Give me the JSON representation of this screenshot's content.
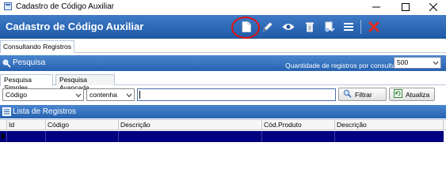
{
  "window": {
    "title": "Cadastro de Código Auxiliar",
    "controls": [
      "minimize",
      "maximize",
      "close"
    ]
  },
  "header": {
    "title": "Cadastro de Código Auxiliar",
    "toolbar_icons": [
      "new-document-icon",
      "edit-pencil-icon",
      "view-eye-icon",
      "delete-trash-icon",
      "import-icon",
      "menu-list-icon",
      "cancel-x-icon"
    ],
    "highlighted": "new-document-icon"
  },
  "context_tab": "Consultando Registros",
  "pesquisa": {
    "title": "Pesquisa",
    "qty_label": "Quantidade de registros por consulta :",
    "qty_value": "500"
  },
  "search_tabs": [
    {
      "label": "Pesquisa Simples",
      "active": true
    },
    {
      "label": "Pesquisa Avançada",
      "active": false
    }
  ],
  "search": {
    "field_value": "Código",
    "operator_value": "contenha",
    "text_value": "",
    "filter_button": "Filtrar",
    "refresh_button": "Atualiza"
  },
  "lista": {
    "title": "Lista de Registros",
    "columns": [
      "Id",
      "Código",
      "Descrição",
      "Cód.Produto",
      "Descrição"
    ]
  },
  "colors": {
    "header_blue": "#2662b0",
    "selected_row": "#000080",
    "highlight_ring": "#e01010"
  }
}
